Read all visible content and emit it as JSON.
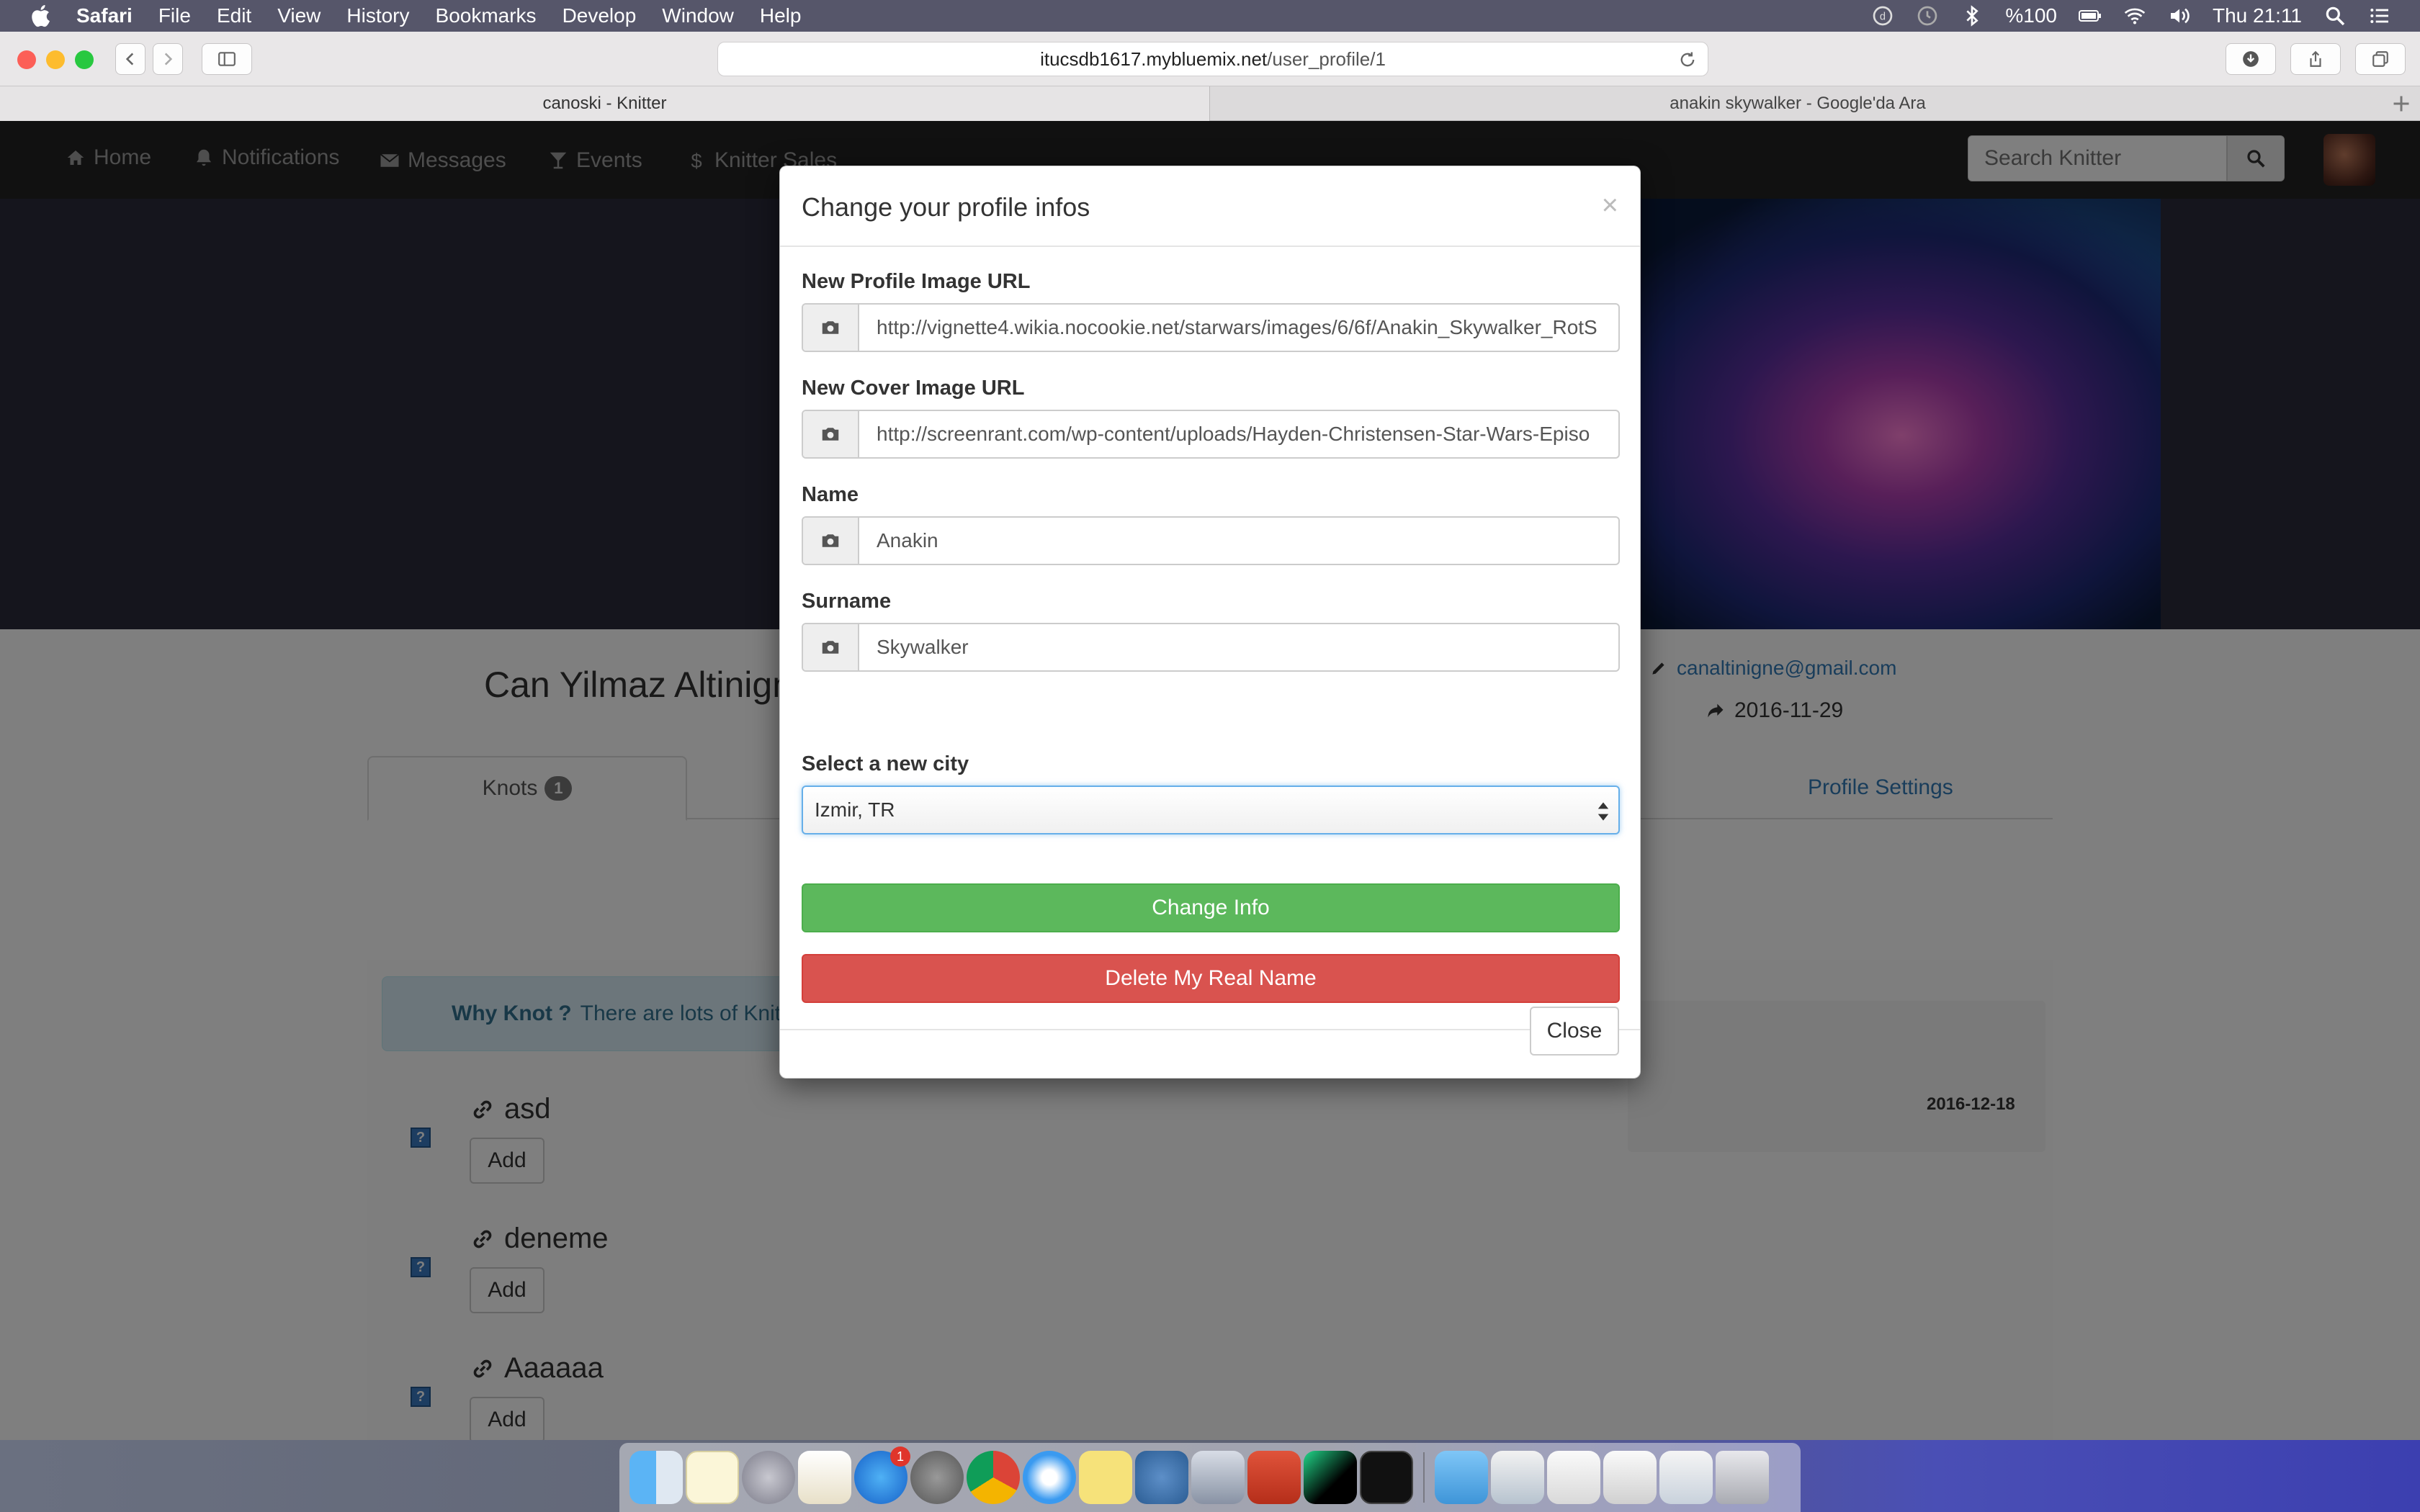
{
  "menubar": {
    "app": "Safari",
    "items": [
      "File",
      "Edit",
      "View",
      "History",
      "Bookmarks",
      "Develop",
      "Window",
      "Help"
    ],
    "battery": "%100",
    "clock": "Thu 21:11"
  },
  "browser": {
    "url_host": "itucsdb1617.mybluemix.net",
    "url_path": "/user_profile/1",
    "tabs": [
      {
        "label": "canoski - Knitter"
      },
      {
        "label": "anakin skywalker - Google'da Ara"
      }
    ]
  },
  "navbar": {
    "items": [
      {
        "label": "Home",
        "icon": "home-icon"
      },
      {
        "label": "Notifications",
        "icon": "bell-icon"
      },
      {
        "label": "Messages",
        "icon": "envelope-icon"
      },
      {
        "label": "Events",
        "icon": "glass-icon"
      },
      {
        "label": "Knitter Sales",
        "icon": "dollar-icon"
      }
    ],
    "search_placeholder": "Search Knitter"
  },
  "profile": {
    "name": "Can Yilmaz Altinign",
    "email": "canaltinigne@gmail.com",
    "date": "2016-11-29",
    "tabs": {
      "knots_label": "Knots",
      "knots_count": "1",
      "settings_label": "Profile Settings"
    },
    "why_knot_bold": "Why Knot ?",
    "why_knot_text": "There are lots of Knitter",
    "knot_date": "2016-12-18",
    "knots": [
      {
        "title": "asd",
        "add_label": "Add",
        "check": "?"
      },
      {
        "title": "deneme",
        "add_label": "Add",
        "check": "?"
      },
      {
        "title": "Aaaaaa",
        "add_label": "Add",
        "check": "?"
      }
    ]
  },
  "modal": {
    "title": "Change your profile infos",
    "close_x": "×",
    "fields": {
      "profile_image_label": "New Profile Image URL",
      "profile_image_value": "http://vignette4.wikia.nocookie.net/starwars/images/6/6f/Anakin_Skywalker_RotS",
      "cover_image_label": "New Cover Image URL",
      "cover_image_value": "http://screenrant.com/wp-content/uploads/Hayden-Christensen-Star-Wars-Episo",
      "name_label": "Name",
      "name_value": "Anakin",
      "surname_label": "Surname",
      "surname_value": "Skywalker",
      "city_label": "Select a new city",
      "city_value": "Izmir, TR"
    },
    "change_info_label": "Change Info",
    "delete_name_label": "Delete My Real Name",
    "close_label": "Close"
  },
  "dock": {
    "app_store_badge": "1"
  },
  "colors": {
    "success": "#5cb85c",
    "danger": "#d9534f",
    "link": "#337ab7",
    "navbar": "#222222"
  }
}
